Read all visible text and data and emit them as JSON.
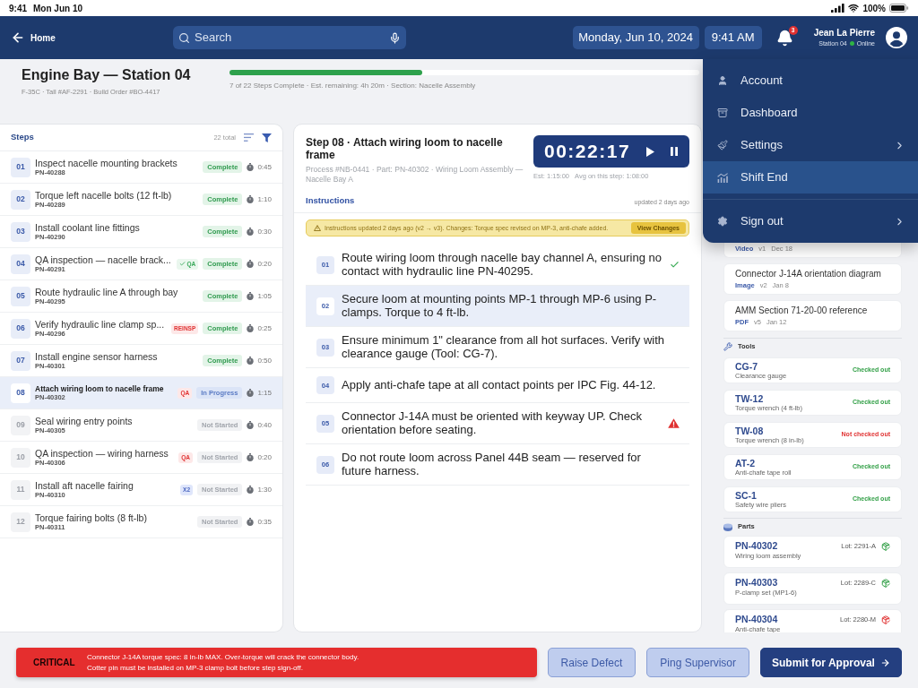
{
  "status_bar": {
    "time": "9:41",
    "date": "Mon Jun 10",
    "battery": "100%"
  },
  "header": {
    "back_label": "Home",
    "search": {
      "placeholder": "Search"
    },
    "date": "Monday, Jun 10, 2024",
    "time": "9:41 AM",
    "notifications": "3",
    "user": {
      "name": "Jean La Pierre",
      "station": "Station 04",
      "status": "Online",
      "online": true
    }
  },
  "page": {
    "title": "Engine Bay — Station 04",
    "meta": "F-35C · Tall #AF-2291 · Build Order #BO-4417",
    "progress": {
      "level": 0.41,
      "summary": "7 of 22 Steps Complete · Est. remaining: 4h 20m · Section: Nacelle Assembly"
    }
  },
  "steps_panel": {
    "title": "Steps",
    "count": "22 total",
    "steps": [
      {
        "number": "01",
        "title": "Inspect nacelle mounting brackets",
        "part": "PN-40288",
        "status": {
          "text": "Complete",
          "kind": "complete"
        },
        "time": "0:45",
        "selected": false
      },
      {
        "number": "02",
        "title": "Torque left nacelle bolts (12 ft-lb)",
        "part": "PN-40289",
        "status": {
          "text": "Complete",
          "kind": "complete"
        },
        "time": "1:10",
        "selected": false
      },
      {
        "number": "03",
        "title": "Install coolant line fittings",
        "part": "PN-40290",
        "status": {
          "text": "Complete",
          "kind": "complete"
        },
        "time": "0:30",
        "selected": false
      },
      {
        "number": "04",
        "title": "QA inspection — nacelle brack...",
        "part": "PN-40291",
        "tag": {
          "text": "QA",
          "kind": "pass"
        },
        "status": {
          "text": "Complete",
          "kind": "complete"
        },
        "time": "0:20",
        "selected": false
      },
      {
        "number": "05",
        "title": "Route hydraulic line A through bay",
        "part": "PN-40295",
        "status": {
          "text": "Complete",
          "kind": "complete"
        },
        "time": "1:05",
        "selected": false
      },
      {
        "number": "06",
        "title": "Verify hydraulic line clamp sp...",
        "part": "PN-40296",
        "tag": {
          "text": "REINSP",
          "kind": "flag"
        },
        "status": {
          "text": "Complete",
          "kind": "complete"
        },
        "time": "0:25",
        "selected": false
      },
      {
        "number": "07",
        "title": "Install engine sensor harness",
        "part": "PN-40301",
        "status": {
          "text": "Complete",
          "kind": "complete"
        },
        "time": "0:50",
        "selected": false
      },
      {
        "number": "08",
        "title": "Attach wiring loom to nacelle frame",
        "part": "PN-40302",
        "tag": {
          "text": "QA",
          "kind": "flag"
        },
        "status": {
          "text": "In Progress",
          "kind": "in_progress"
        },
        "time": "1:15",
        "selected": true
      },
      {
        "number": "09",
        "title": "Seal wiring entry points",
        "part": "PN-40305",
        "status": {
          "text": "Not Started",
          "kind": "not_started"
        },
        "time": "0:40",
        "selected": false
      },
      {
        "number": "10",
        "title": "QA inspection — wiring harness",
        "part": "PN-40306",
        "tag": {
          "text": "QA",
          "kind": "flag"
        },
        "status": {
          "text": "Not Started",
          "kind": "not_started"
        },
        "time": "0:20",
        "selected": false
      },
      {
        "number": "11",
        "title": "Install aft nacelle fairing",
        "part": "PN-40310",
        "tag": {
          "text": "X2",
          "kind": "count"
        },
        "status": {
          "text": "Not Started",
          "kind": "not_started"
        },
        "time": "1:30",
        "selected": false
      },
      {
        "number": "12",
        "title": "Torque fairing bolts (8 ft-lb)",
        "part": "PN-40311",
        "status": {
          "text": "Not Started",
          "kind": "not_started"
        },
        "time": "0:35",
        "selected": false
      }
    ]
  },
  "step_detail": {
    "title": "Step 08 · Attach wiring loom to nacelle frame",
    "meta": "Process #NB-0441 · Part: PN-40302 · Wiring Loom Assembly — Nacelle Bay A",
    "timer": {
      "elapsed": "00:22:17",
      "estimate": "Est: 1:15:00",
      "average": "Avg on this step: 1:08:00"
    },
    "instructions_title": "Instructions",
    "updated": "updated 2 days ago",
    "notice": {
      "text": "Instructions updated 2 days ago (v2 → v3). Changes: Torque spec revised on MP-3, anti-chafe added.",
      "action": "View Changes"
    },
    "instructions": [
      {
        "number": "01",
        "text": "Route wiring loom through nacelle bay channel A, ensuring no contact with hydraulic line PN-40295.",
        "selected": false,
        "kind": "done"
      },
      {
        "number": "02",
        "text": "Secure loom at mounting points MP-1 through MP-6 using P-clamps. Torque to 4 ft-lb.",
        "selected": true,
        "kind": "plain"
      },
      {
        "number": "03",
        "text": "Ensure minimum 1\" clearance from all hot surfaces. Verify with clearance gauge (Tool: CG-7).",
        "selected": false,
        "kind": "plain"
      },
      {
        "number": "04",
        "text": "Apply anti-chafe tape at all contact points per IPC Fig. 44-12.",
        "selected": false,
        "kind": "plain"
      },
      {
        "number": "05",
        "text": "Connector J-14A must be oriented with keyway UP. Check orientation before seating.",
        "selected": false,
        "kind": "warning"
      },
      {
        "number": "06",
        "text": "Do not route loom across Panel 44B seam — reserved for future harness.",
        "selected": false,
        "kind": "plain"
      }
    ]
  },
  "resources": {
    "documents": [
      {
        "type": "Video",
        "version": "v1",
        "date": "Dec 18"
      },
      {
        "title": "Connector J-14A orientation diagram",
        "type": "Image",
        "version": "v2",
        "date": "Jan 8"
      },
      {
        "title": "AMM Section 71-20-00 reference",
        "type": "PDF",
        "version": "v5",
        "date": "Jan 12"
      }
    ],
    "tools_title": "Tools",
    "tools": [
      {
        "code": "CG-7",
        "name": "Clearance gauge",
        "status": "Checked out",
        "checked_out": true
      },
      {
        "code": "TW-12",
        "name": "Torque wrench (4 ft-lb)",
        "status": "Checked out",
        "checked_out": true
      },
      {
        "code": "TW-08",
        "name": "Torque wrench (8 in-lb)",
        "status": "Not checked out",
        "checked_out": false
      },
      {
        "code": "AT-2",
        "name": "Anti-chafe tape roll",
        "status": "Checked out",
        "checked_out": true
      },
      {
        "code": "SC-1",
        "name": "Safety wire pliers",
        "status": "Checked out",
        "checked_out": true
      }
    ],
    "parts_title": "Parts",
    "parts": [
      {
        "code": "PN-40302",
        "name": "Wiring loom assembly",
        "lot": "Lot: 2291-A",
        "verified": true
      },
      {
        "code": "PN-40303",
        "name": "P-clamp set (MP1-6)",
        "lot": "Lot: 2289-C",
        "verified": true
      },
      {
        "code": "PN-40304",
        "name": "Anti-chafe tape",
        "lot": "Lot: 2280-M",
        "verified": false
      }
    ]
  },
  "menu": {
    "items": [
      {
        "label": "Account",
        "selected": false,
        "submenu": false
      },
      {
        "label": "Dashboard",
        "selected": false,
        "submenu": false
      },
      {
        "label": "Settings",
        "selected": false,
        "submenu": true
      },
      {
        "label": "Shift End",
        "selected": true,
        "submenu": false
      },
      {
        "label": "Sign out",
        "selected": false,
        "submenu": true
      }
    ]
  },
  "footer": {
    "alert": {
      "label": "CRITICAL",
      "lines": [
        "Connector J-14A torque spec: 8 in-lb MAX. Over-torque will crack the connector body.",
        "Cotter pin must be installed on MP-3 clamp bolt before step sign-off."
      ]
    },
    "buttons": [
      {
        "label": "Raise Defect",
        "kind": "secondary"
      },
      {
        "label": "Ping Supervisor",
        "kind": "secondary"
      },
      {
        "label": "Submit for Approval",
        "kind": "primary"
      }
    ]
  }
}
